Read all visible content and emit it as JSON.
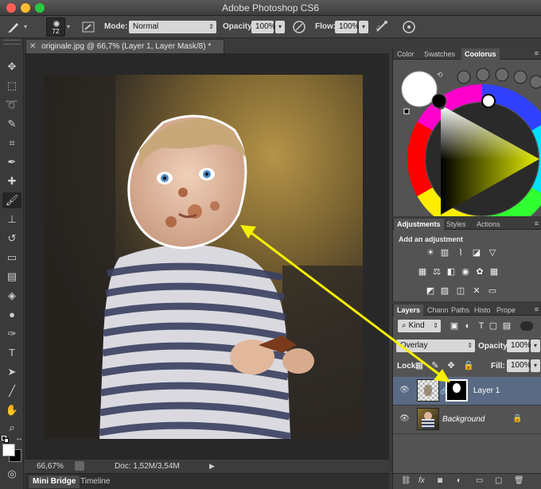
{
  "window": {
    "title": "Adobe Photoshop CS6"
  },
  "options": {
    "brush_size": "72",
    "mode_label": "Mode:",
    "mode_value": "Normal",
    "opacity_label": "Opacity:",
    "opacity_value": "100%",
    "flow_label": "Flow:",
    "flow_value": "100%"
  },
  "document": {
    "tab_title": "originale.jpg @ 66,7% (Layer 1, Layer Mask/8) *",
    "zoom": "66,67%",
    "doc_info": "Doc: 1,52M/3,54M"
  },
  "bottom_tabs": [
    "Mini Bridge",
    "Timeline"
  ],
  "color_panel": {
    "tabs": [
      "Color",
      "Swatches",
      "Coolorus"
    ]
  },
  "adjustments_panel": {
    "tabs": [
      "Adjustments",
      "Styles",
      "Actions"
    ],
    "heading": "Add an adjustment"
  },
  "layers_panel": {
    "tabs": [
      "Layers",
      "Chann",
      "Paths",
      "Histo",
      "Prope"
    ],
    "filter_kind": "Kind",
    "blend_mode": "Overlay",
    "opacity_label": "Opacity:",
    "opacity_value": "100%",
    "lock_label": "Lock:",
    "fill_label": "Fill:",
    "fill_value": "100%",
    "layers": [
      {
        "name": "Layer 1"
      },
      {
        "name": "Background"
      }
    ]
  },
  "colors": {
    "accent_yellow": "#f5f000",
    "layer_selected_bg": "#5a6a84"
  }
}
